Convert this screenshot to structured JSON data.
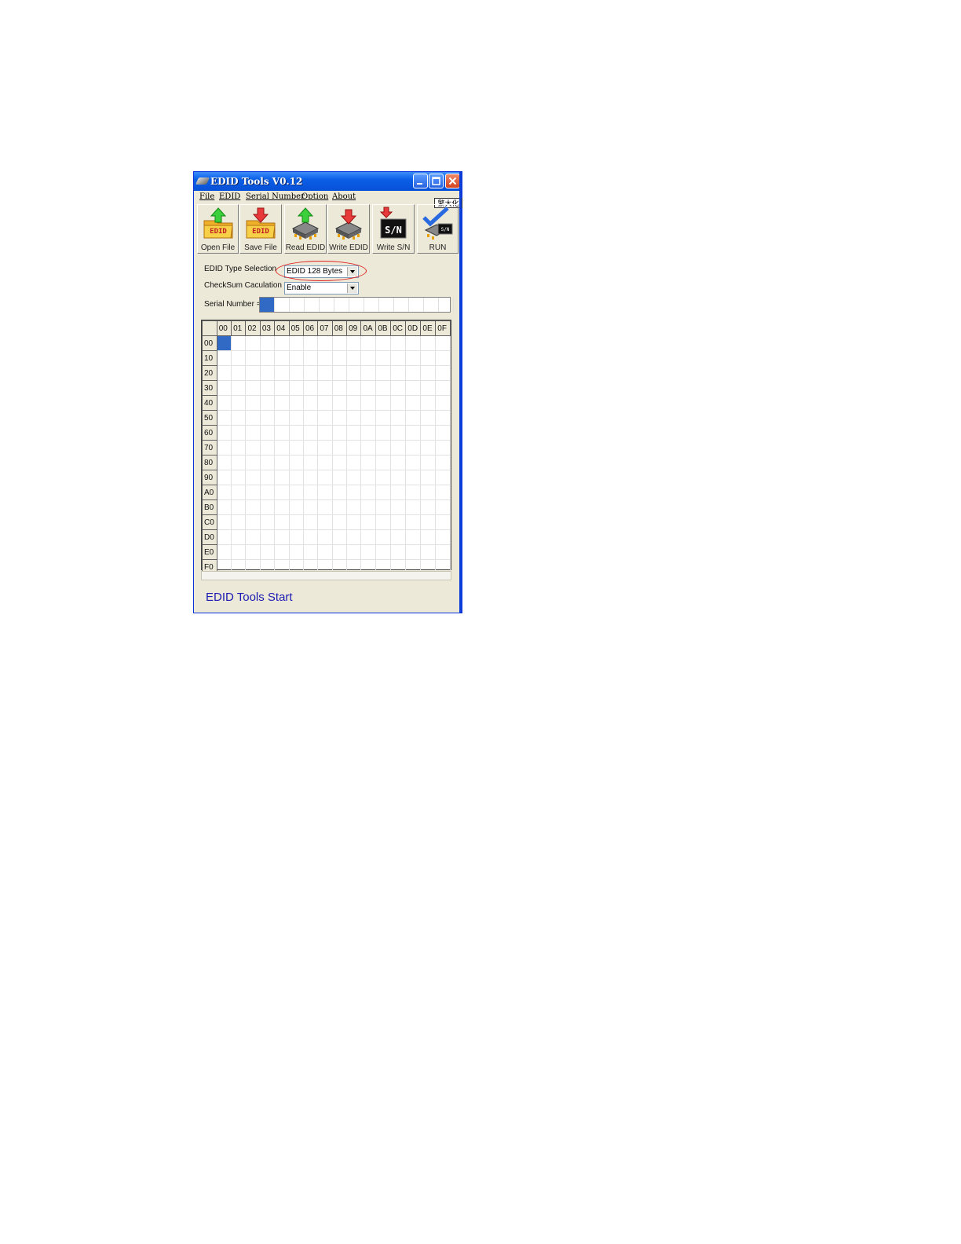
{
  "window": {
    "title": "EDID Tools V0.12",
    "ime_indicator": "繁大化"
  },
  "menu": [
    "File",
    "EDID",
    "Serial Number",
    "Option",
    "About"
  ],
  "toolbar": [
    {
      "label": "Open File",
      "icon": "open-edid-file-icon"
    },
    {
      "label": "Save File",
      "icon": "save-edid-file-icon"
    },
    {
      "label": "Read EDID",
      "icon": "read-edid-chip-icon"
    },
    {
      "label": "Write EDID",
      "icon": "write-edid-chip-icon"
    },
    {
      "label": "Write S/N",
      "icon": "write-serial-number-icon"
    },
    {
      "label": "RUN",
      "icon": "run-check-icon"
    }
  ],
  "icon_texts": {
    "edid": "EDID",
    "sn": "S/N"
  },
  "form": {
    "edid_type_label": "EDID Type Selection",
    "edid_type_value": "EDID 128 Bytes",
    "checksum_label": "CheckSum Caculation",
    "checksum_value": "Enable",
    "serial_label": "Serial Number ="
  },
  "grid": {
    "col_headers": [
      "00",
      "01",
      "02",
      "03",
      "04",
      "05",
      "06",
      "07",
      "08",
      "09",
      "0A",
      "0B",
      "0C",
      "0D",
      "0E",
      "0F"
    ],
    "row_headers": [
      "00",
      "10",
      "20",
      "30",
      "40",
      "50",
      "60",
      "70",
      "80",
      "90",
      "A0",
      "B0",
      "C0",
      "D0",
      "E0",
      "F0"
    ]
  },
  "status": "EDID Tools Start",
  "colors": {
    "accent": "#316ac5",
    "title_blue": "#0a5fe6",
    "highlight": "#e02020",
    "status_text": "#1b1bb3"
  }
}
